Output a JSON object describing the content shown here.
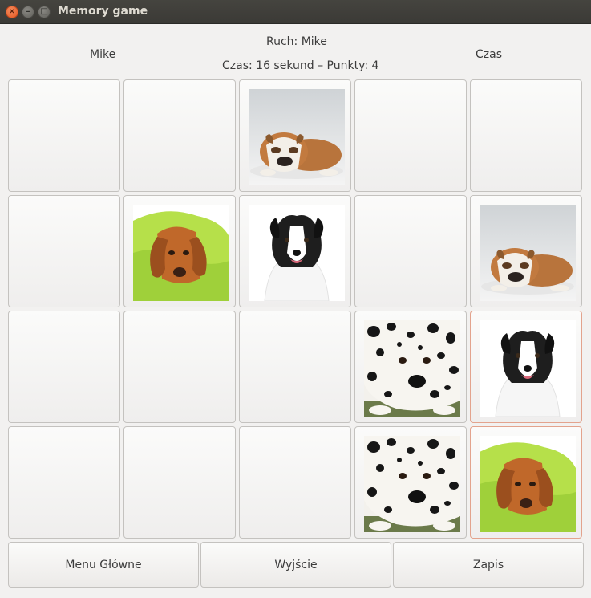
{
  "window": {
    "title": "Memory game"
  },
  "header": {
    "player_left": "Mike",
    "turn": "Ruch: Mike",
    "status": "Czas: 16 sekund – Punkty: 4",
    "player_right": "Czas"
  },
  "board": {
    "rows": 4,
    "cols": 5,
    "cards": [
      {
        "state": "hidden"
      },
      {
        "state": "hidden"
      },
      {
        "state": "revealed",
        "image": "bulldog"
      },
      {
        "state": "hidden"
      },
      {
        "state": "hidden"
      },
      {
        "state": "hidden"
      },
      {
        "state": "revealed",
        "image": "dachshund"
      },
      {
        "state": "revealed",
        "image": "border-collie"
      },
      {
        "state": "hidden"
      },
      {
        "state": "revealed",
        "image": "bulldog"
      },
      {
        "state": "hidden"
      },
      {
        "state": "hidden"
      },
      {
        "state": "hidden"
      },
      {
        "state": "revealed",
        "image": "dalmatian"
      },
      {
        "state": "revealed",
        "image": "border-collie",
        "selected": true
      },
      {
        "state": "hidden"
      },
      {
        "state": "hidden"
      },
      {
        "state": "hidden"
      },
      {
        "state": "revealed",
        "image": "dalmatian"
      },
      {
        "state": "revealed",
        "image": "dachshund",
        "selected": true
      }
    ]
  },
  "buttons": {
    "menu": "Menu Główne",
    "exit": "Wyjście",
    "save": "Zapis"
  },
  "colors": {
    "window_bg": "#f2f1f0",
    "titlebar": "#3e3d39",
    "selected_border": "#e3a38d",
    "close_button": "#e95420"
  }
}
